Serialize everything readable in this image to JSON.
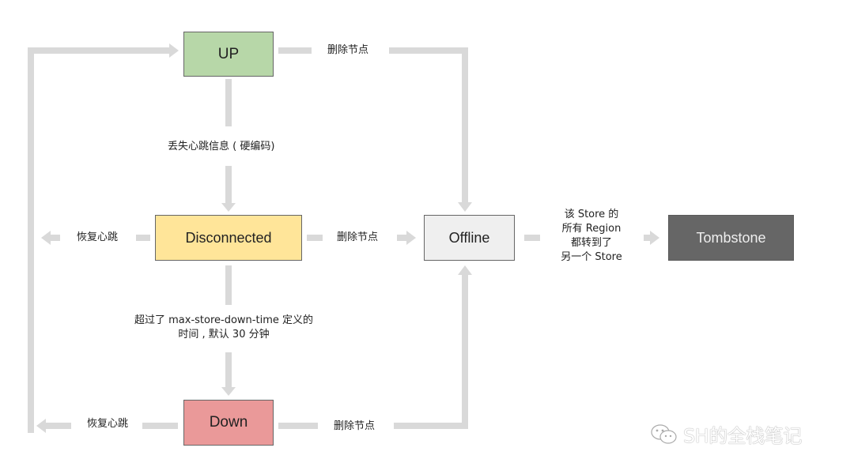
{
  "nodes": {
    "up": {
      "label": "UP",
      "color": "#b7d7a8"
    },
    "disconnected": {
      "label": "Disconnected",
      "color": "#ffe599"
    },
    "offline": {
      "label": "Offline",
      "color": "#efefef"
    },
    "tombstone": {
      "label": "Tombstone",
      "color": "#666666",
      "text_color": "#eeeeee"
    },
    "down": {
      "label": "Down",
      "color": "#ea9999"
    }
  },
  "edges": {
    "up_to_offline": "删除节点",
    "up_to_disconnected": "丢失心跳信息 ( 硬编码)",
    "disconnected_to_up": "恢复心跳",
    "disconnected_to_offline": "删除节点",
    "disconnected_to_down_line1": "超过了 max-store-down-time  定义的",
    "disconnected_to_down_line2": "时间 , 默认 30 分钟",
    "offline_to_tombstone_line1": "该 Store 的",
    "offline_to_tombstone_line2": "所有 Region",
    "offline_to_tombstone_line3": "都转到了",
    "offline_to_tombstone_line4": "另一个 Store",
    "down_to_up": "恢复心跳",
    "down_to_offline": "删除节点"
  },
  "arrow_color": "#d9d9d9",
  "watermark": {
    "icon": "wechat-icon",
    "text": "SH的全栈笔记"
  }
}
